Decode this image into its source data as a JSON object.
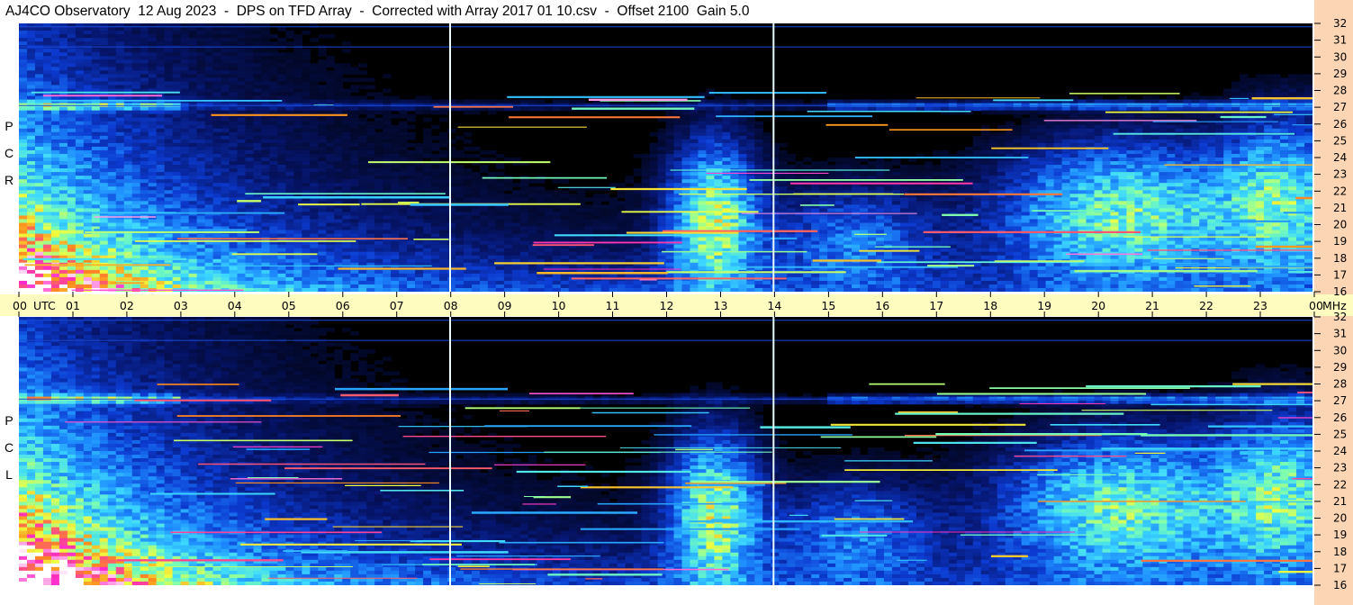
{
  "title": "AJ4CO Observatory  12 Aug 2023  -  DPS on TFD Array  -  Corrected with Array 2017 01 10.csv  -  Offset 2100  Gain 5.0",
  "panels": [
    {
      "id": "rcp",
      "label_letters": [
        "P",
        "C",
        "R"
      ]
    },
    {
      "id": "lcp",
      "label_letters": [
        "P",
        "C",
        "L"
      ]
    }
  ],
  "colors": {
    "background": "#000000",
    "utc_band": "#fffcc0",
    "right_strip": "#fcd6b4",
    "marker_line": "#e8fbff",
    "colormap": [
      "#000000",
      "#061468",
      "#0c3ad0",
      "#1e8cff",
      "#3cd8ff",
      "#7cffb0",
      "#f0ff40",
      "#ff8a1c",
      "#ff28c8",
      "#ffffff"
    ]
  },
  "chart_data": {
    "type": "heatmap",
    "title": "AJ4CO Observatory  12 Aug 2023  -  DPS on TFD Array  -  Corrected with Array 2017 01 10.csv  -  Offset 2100  Gain 5.0",
    "x_axis": {
      "unit_label": "UTC",
      "ticks": [
        "00",
        "01",
        "02",
        "03",
        "04",
        "05",
        "06",
        "07",
        "08",
        "09",
        "10",
        "11",
        "12",
        "13",
        "14",
        "15",
        "16",
        "17",
        "18",
        "19",
        "20",
        "21",
        "22",
        "23",
        "00"
      ],
      "range_hours": [
        0,
        24
      ]
    },
    "y_axis": {
      "unit_label": "MHz",
      "ticks": [
        16,
        17,
        18,
        19,
        20,
        21,
        22,
        23,
        24,
        25,
        26,
        27,
        28,
        29,
        30,
        31,
        32
      ],
      "range_mhz": [
        16,
        32
      ]
    },
    "marker_times_hours": [
      8,
      14
    ],
    "panels": [
      "RCP",
      "LCP"
    ]
  }
}
